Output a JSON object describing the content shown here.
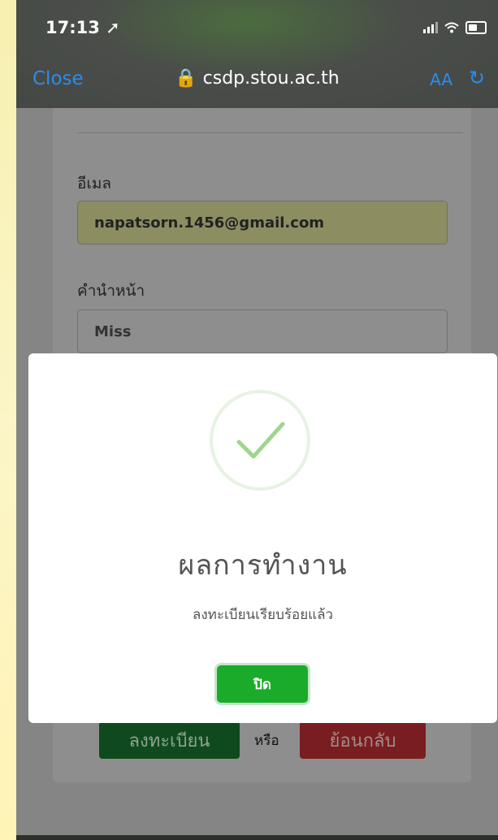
{
  "status_bar": {
    "time": "17:13 ➚"
  },
  "browser": {
    "close_label": "Close",
    "url": "🔒 csdp.stou.ac.th",
    "text_size_label": "AA",
    "reload_icon": "reload-icon"
  },
  "form": {
    "email_label": "อีเมล",
    "email_value": "napatsorn.1456@gmail.com",
    "prefix_label": "คำนำหน้า",
    "prefix_value": "Miss",
    "register_button": "ลงทะเบียน",
    "or_text": "หรือ",
    "back_button": "ย้อนกลับ"
  },
  "modal": {
    "icon": "success-check-icon",
    "title": "ผลการทำงาน",
    "message": "ลงทะเบียนเรียบร้อยแล้ว",
    "close_button": "ปิด",
    "accent_color": "#1aab2a"
  }
}
